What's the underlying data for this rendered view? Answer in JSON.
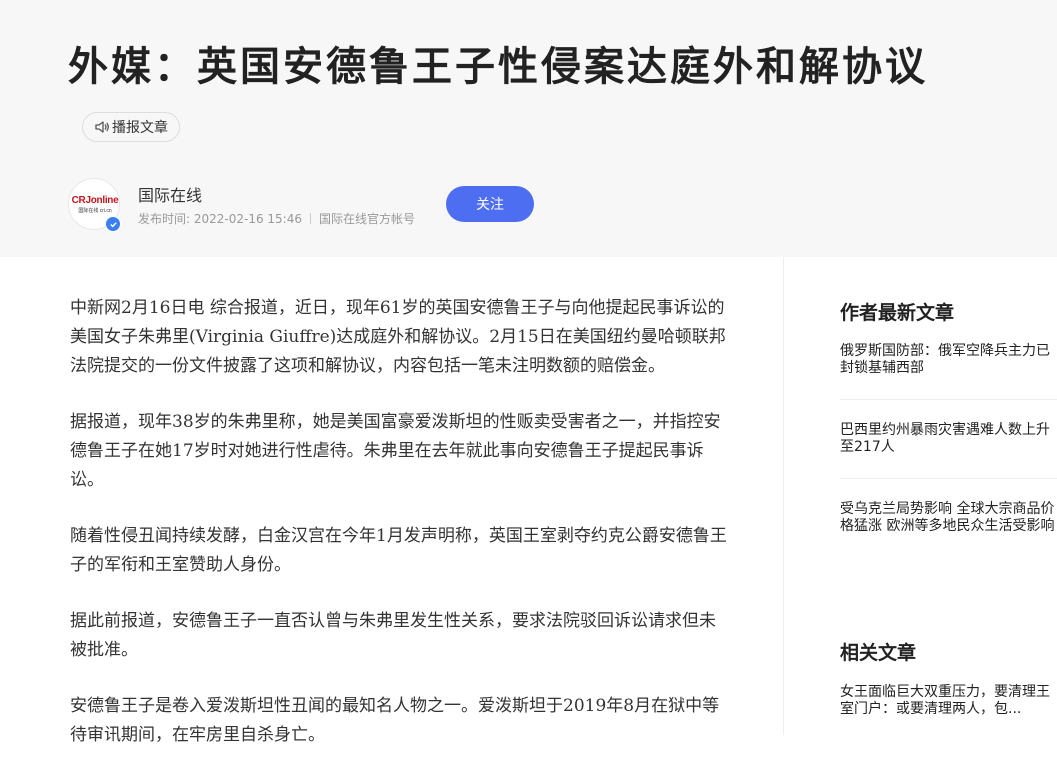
{
  "article": {
    "title": "外媒：英国安德鲁王子性侵案达庭外和解协议",
    "listen_label": "播报文章",
    "paragraphs": [
      "中新网2月16日电 综合报道，近日，现年61岁的英国安德鲁王子与向他提起民事诉讼的美国女子朱弗里(Virginia Giuffre)达成庭外和解协议。2月15日在美国纽约曼哈顿联邦法院提交的一份文件披露了这项和解协议，内容包括一笔未注明数额的赔偿金。",
      "据报道，现年38岁的朱弗里称，她是美国富豪爱泼斯坦的性贩卖受害者之一，并指控安德鲁王子在她17岁时对她进行性虐待。朱弗里在去年就此事向安德鲁王子提起民事诉讼。",
      "随着性侵丑闻持续发酵，白金汉宫在今年1月发声明称，英国王室剥夺约克公爵安德鲁王子的军衔和王室赞助人身份。",
      "据此前报道，安德鲁王子一直否认曾与朱弗里发生性关系，要求法院驳回诉讼请求但未被批准。",
      "安德鲁王子是卷入爱泼斯坦性丑闻的最知名人物之一。爱泼斯坦于2019年8月在狱中等待审讯期间，在牢房里自杀身亡。"
    ]
  },
  "author": {
    "name": "国际在线",
    "logo_text": "CRJonline",
    "logo_subtext": "国际在线 cri.cn",
    "publish_time": "发布时间: 2022-02-16 15:46",
    "account_type": "国际在线官方帐号",
    "follow_label": "关注"
  },
  "sidebar": {
    "latest_heading": "作者最新文章",
    "latest_items": [
      "俄罗斯国防部：俄军空降兵主力已封锁基辅西部",
      "巴西里约州暴雨灾害遇难人数上升至217人",
      "受乌克兰局势影响 全球大宗商品价格猛涨 欧洲等多地民众生活受影响"
    ],
    "related_heading": "相关文章",
    "related_items": [
      "女王面临巨大双重压力，要清理王室门户：或要清理两人，包..."
    ]
  },
  "colors": {
    "header_bg": "#f7f7f7",
    "follow_button": "#4e6ef2",
    "verify_badge": "#3b7ff1",
    "logo_red": "#c0161d"
  }
}
